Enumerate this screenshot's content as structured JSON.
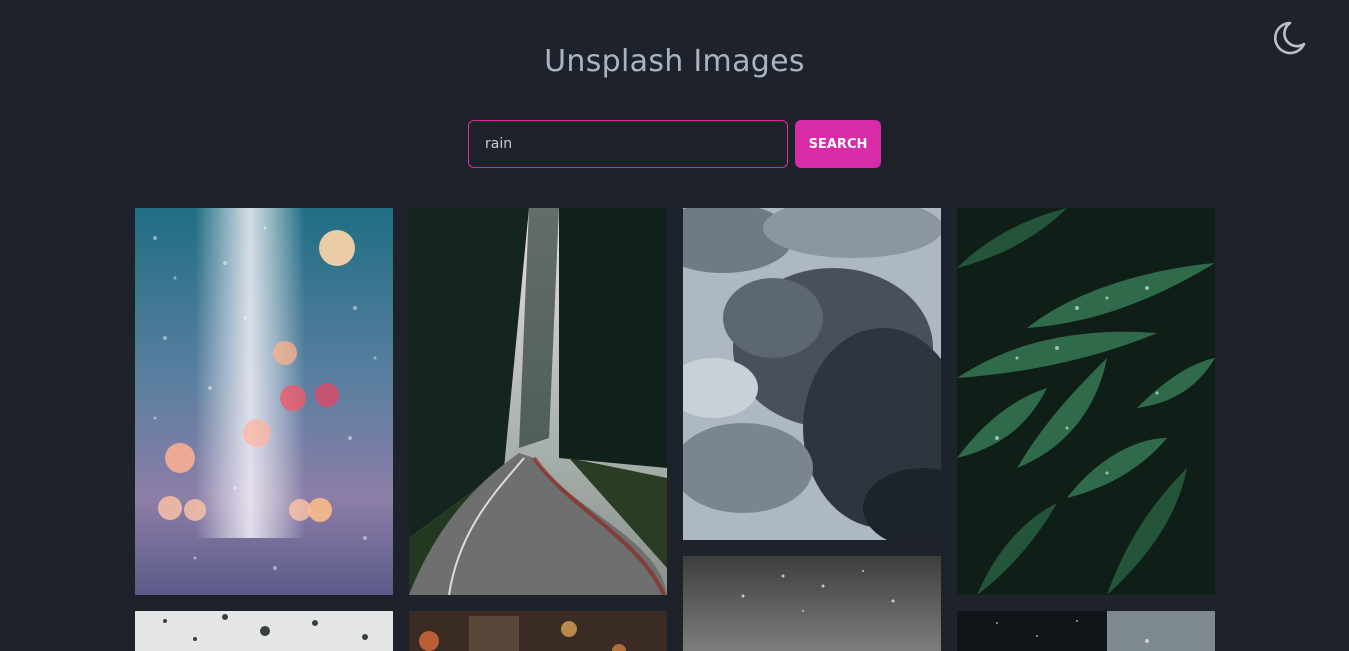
{
  "header": {
    "title": "Unsplash Images",
    "theme_toggle_icon": "moon-icon"
  },
  "search": {
    "value": "rain",
    "button_label": "SEARCH"
  },
  "gallery": {
    "images": [
      {
        "subject": "rain-window-bokeh"
      },
      {
        "subject": "forest-road"
      },
      {
        "subject": "storm-clouds"
      },
      {
        "subject": "wet-leaves"
      },
      {
        "subject": "water-drops"
      },
      {
        "subject": "city-street"
      },
      {
        "subject": "rain-on-water"
      },
      {
        "subject": "dark-window-drops"
      }
    ]
  },
  "colors": {
    "background": "#1e222b",
    "accent": "#d92aa8",
    "title": "#aab3c4"
  }
}
